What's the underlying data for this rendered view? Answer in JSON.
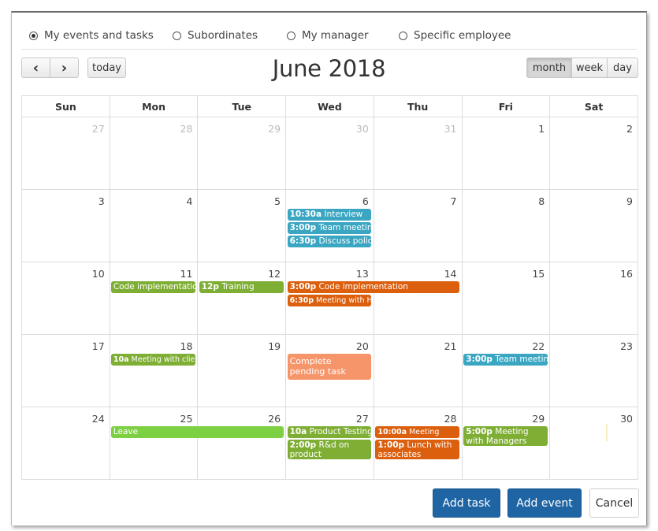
{
  "filters": [
    {
      "label": "My events and tasks",
      "selected": true
    },
    {
      "label": "Subordinates",
      "selected": false
    },
    {
      "label": "My manager",
      "selected": false
    },
    {
      "label": "Specific employee",
      "selected": false
    }
  ],
  "toolbar": {
    "prev_icon": "‹",
    "next_icon": "›",
    "today_label": "today",
    "title": "June 2018",
    "views": [
      {
        "label": "month",
        "active": true
      },
      {
        "label": "week",
        "active": false
      },
      {
        "label": "day",
        "active": false
      }
    ]
  },
  "weekdays": [
    "Sun",
    "Mon",
    "Tue",
    "Wed",
    "Thu",
    "Fri",
    "Sat"
  ],
  "weeks": [
    [
      {
        "d": "27",
        "other": true
      },
      {
        "d": "28",
        "other": true
      },
      {
        "d": "29",
        "other": true
      },
      {
        "d": "30",
        "other": true
      },
      {
        "d": "31",
        "other": true
      },
      {
        "d": "1"
      },
      {
        "d": "2"
      }
    ],
    [
      {
        "d": "3"
      },
      {
        "d": "4"
      },
      {
        "d": "5"
      },
      {
        "d": "6"
      },
      {
        "d": "7"
      },
      {
        "d": "8"
      },
      {
        "d": "9"
      }
    ],
    [
      {
        "d": "10"
      },
      {
        "d": "11"
      },
      {
        "d": "12"
      },
      {
        "d": "13"
      },
      {
        "d": "14"
      },
      {
        "d": "15"
      },
      {
        "d": "16"
      }
    ],
    [
      {
        "d": "17"
      },
      {
        "d": "18"
      },
      {
        "d": "19"
      },
      {
        "d": "20"
      },
      {
        "d": "21"
      },
      {
        "d": "22"
      },
      {
        "d": "23"
      }
    ],
    [
      {
        "d": "24"
      },
      {
        "d": "25"
      },
      {
        "d": "26"
      },
      {
        "d": "27"
      },
      {
        "d": "28"
      },
      {
        "d": "29"
      },
      {
        "d": "30"
      }
    ]
  ],
  "colors": {
    "teal": "#3aa6c2",
    "green": "#7fae35",
    "lightgreen": "#7ed043",
    "orange": "#dc5f0e",
    "salmon": "#f7956a",
    "primary": "#1f64a3"
  },
  "events": [
    {
      "week": 1,
      "day": 3,
      "span": 1,
      "slot": 0,
      "time": "10:30a",
      "title": "Interview",
      "color": "teal"
    },
    {
      "week": 1,
      "day": 3,
      "span": 1,
      "slot": 1,
      "time": "3:00p",
      "title": "Team meeting",
      "color": "teal"
    },
    {
      "week": 1,
      "day": 3,
      "span": 1,
      "slot": 2,
      "time": "6:30p",
      "title": "Discuss policy",
      "color": "teal"
    },
    {
      "week": 2,
      "day": 1,
      "span": 1,
      "slot": 0,
      "time": "",
      "title": "Code implementation",
      "color": "green"
    },
    {
      "week": 2,
      "day": 2,
      "span": 1,
      "slot": 0,
      "time": "12p",
      "title": "Training",
      "color": "green"
    },
    {
      "week": 2,
      "day": 3,
      "span": 2,
      "slot": 0,
      "time": "3:00p",
      "title": "Code implementation",
      "color": "orange"
    },
    {
      "week": 2,
      "day": 3,
      "span": 1,
      "slot": 1,
      "time": "6:30p",
      "title": "Meeting with HR",
      "color": "orange",
      "small": true
    },
    {
      "week": 3,
      "day": 1,
      "span": 1,
      "slot": 0,
      "time": "10a",
      "title": "Meeting with client",
      "color": "green",
      "small": true
    },
    {
      "week": 3,
      "day": 3,
      "span": 1,
      "slot": 0,
      "time": "",
      "title": "Complete pending task",
      "color": "salmon",
      "wrap": true,
      "tall": true
    },
    {
      "week": 3,
      "day": 5,
      "span": 1,
      "slot": 0,
      "time": "3:00p",
      "title": "Team meeting",
      "color": "teal"
    },
    {
      "week": 4,
      "day": 1,
      "span": 2,
      "slot": 0,
      "time": "",
      "title": "Leave",
      "color": "lightgreen"
    },
    {
      "week": 4,
      "day": 3,
      "span": 1,
      "slot": 0,
      "time": "10a",
      "title": "Product Testing",
      "color": "green"
    },
    {
      "week": 4,
      "day": 3,
      "span": 1,
      "slot": 1,
      "time": "2:00p",
      "title": "R&d on product",
      "color": "green",
      "wrap": true
    },
    {
      "week": 4,
      "day": 4,
      "span": 1,
      "slot": 0,
      "time": "10:00a",
      "title": "Meeting",
      "color": "orange",
      "small": true
    },
    {
      "week": 4,
      "day": 4,
      "span": 1,
      "slot": 1,
      "time": "1:00p",
      "title": "Lunch with associates",
      "color": "orange",
      "wrap": true
    },
    {
      "week": 4,
      "day": 5,
      "span": 1,
      "slot": 0,
      "time": "5:00p",
      "title": "Meeting with Managers",
      "color": "green",
      "wrap": true
    }
  ],
  "footer": {
    "add_task": "Add task",
    "add_event": "Add event",
    "cancel": "Cancel"
  }
}
